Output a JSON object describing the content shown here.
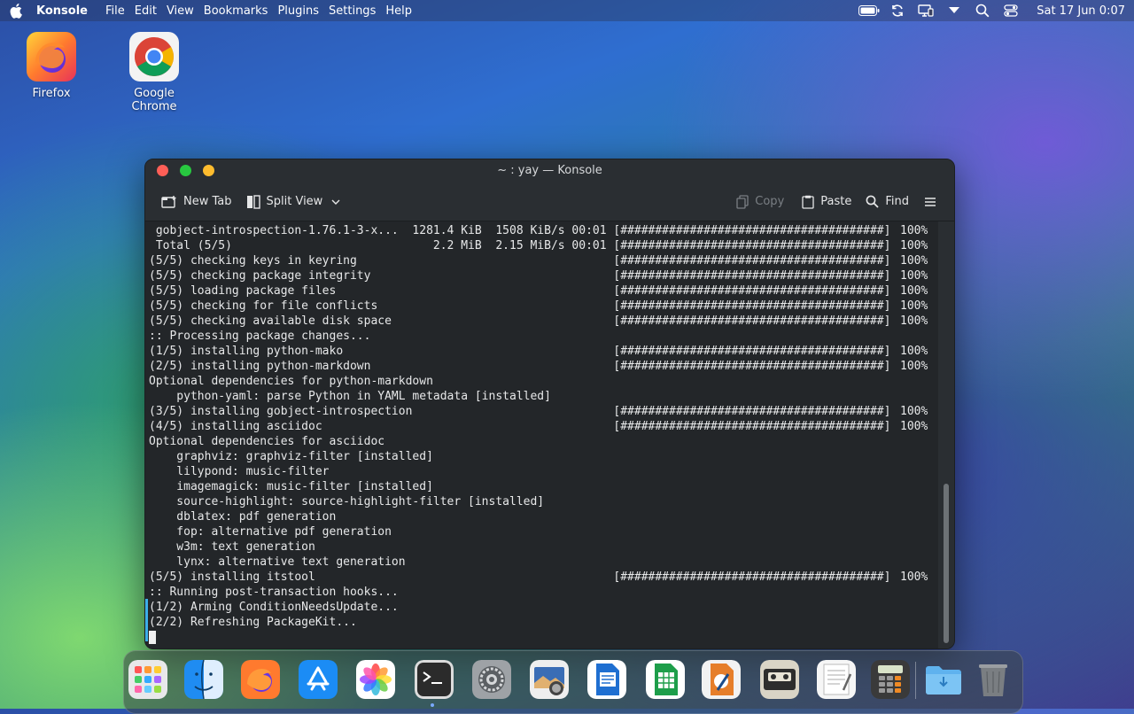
{
  "menubar": {
    "app_name": "Konsole",
    "menus": [
      "File",
      "Edit",
      "View",
      "Bookmarks",
      "Plugins",
      "Settings",
      "Help"
    ],
    "clock": "Sat 17 Jun 0:07"
  },
  "desktop": {
    "icons": [
      {
        "label": "Firefox",
        "icon": "firefox-icon"
      },
      {
        "label": "Google Chrome",
        "icon": "chrome-icon"
      }
    ]
  },
  "window": {
    "title": "~ : yay — Konsole",
    "toolbar": {
      "new_tab": "New Tab",
      "split_view": "Split View",
      "copy": "Copy",
      "paste": "Paste",
      "find": "Find"
    },
    "terminal": {
      "lines": [
        {
          "text": " gobject-introspection-1.76.1-3-x...  1281.4 KiB  1508 KiB/s 00:01 [######################################]",
          "pct": "100%"
        },
        {
          "text": " Total (5/5)                             2.2 MiB  2.15 MiB/s 00:01 [######################################]",
          "pct": "100%"
        },
        {
          "text": "(5/5) checking keys in keyring                                     [######################################]",
          "pct": "100%"
        },
        {
          "text": "(5/5) checking package integrity                                   [######################################]",
          "pct": "100%"
        },
        {
          "text": "(5/5) loading package files                                        [######################################]",
          "pct": "100%"
        },
        {
          "text": "(5/5) checking for file conflicts                                  [######################################]",
          "pct": "100%"
        },
        {
          "text": "(5/5) checking available disk space                                [######################################]",
          "pct": "100%"
        },
        {
          "text": ":: Processing package changes...",
          "pct": ""
        },
        {
          "text": "(1/5) installing python-mako                                       [######################################]",
          "pct": "100%"
        },
        {
          "text": "(2/5) installing python-markdown                                   [######################################]",
          "pct": "100%"
        },
        {
          "text": "Optional dependencies for python-markdown",
          "pct": ""
        },
        {
          "text": "    python-yaml: parse Python in YAML metadata [installed]",
          "pct": ""
        },
        {
          "text": "(3/5) installing gobject-introspection                             [######################################]",
          "pct": "100%"
        },
        {
          "text": "(4/5) installing asciidoc                                          [######################################]",
          "pct": "100%"
        },
        {
          "text": "Optional dependencies for asciidoc",
          "pct": ""
        },
        {
          "text": "    graphviz: graphviz-filter [installed]",
          "pct": ""
        },
        {
          "text": "    lilypond: music-filter",
          "pct": ""
        },
        {
          "text": "    imagemagick: music-filter [installed]",
          "pct": ""
        },
        {
          "text": "    source-highlight: source-highlight-filter [installed]",
          "pct": ""
        },
        {
          "text": "    dblatex: pdf generation",
          "pct": ""
        },
        {
          "text": "    fop: alternative pdf generation",
          "pct": ""
        },
        {
          "text": "    w3m: text generation",
          "pct": ""
        },
        {
          "text": "    lynx: alternative text generation",
          "pct": ""
        },
        {
          "text": "(5/5) installing itstool                                           [######################################]",
          "pct": "100%"
        },
        {
          "text": ":: Running post-transaction hooks...",
          "pct": ""
        },
        {
          "text": "(1/2) Arming ConditionNeedsUpdate...",
          "pct": ""
        },
        {
          "text": "(2/2) Refreshing PackageKit...",
          "pct": ""
        }
      ]
    }
  },
  "dock": {
    "items": [
      {
        "icon": "launchpad-icon"
      },
      {
        "icon": "finder-icon"
      },
      {
        "icon": "firefox-icon"
      },
      {
        "icon": "app-store-icon"
      },
      {
        "icon": "photos-icon"
      },
      {
        "icon": "terminal-icon"
      },
      {
        "icon": "system-settings-icon"
      },
      {
        "icon": "screenshot-icon"
      },
      {
        "icon": "writer-icon"
      },
      {
        "icon": "spreadsheet-icon"
      },
      {
        "icon": "draw-icon"
      },
      {
        "icon": "cassette-icon"
      },
      {
        "icon": "text-editor-icon"
      },
      {
        "icon": "calculator-icon"
      },
      {
        "icon": "downloads-folder-icon"
      },
      {
        "icon": "trash-icon"
      }
    ]
  }
}
